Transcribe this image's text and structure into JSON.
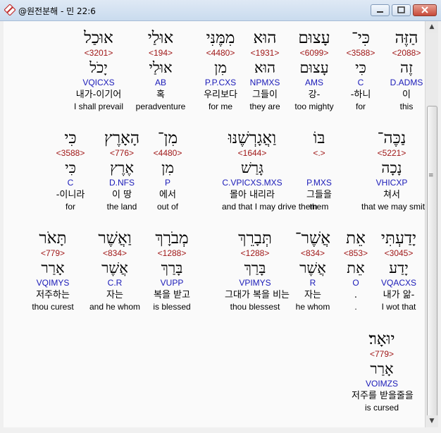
{
  "window": {
    "title": "@원전분해 - 민 22:6"
  },
  "rows": [
    [
      {
        "heb": "הַזֶּה",
        "num": "<2088>",
        "root": "זֶה",
        "parse": "D.ADMS",
        "kor": "이",
        "eng": "this"
      },
      {
        "heb": "כִּי־",
        "num": "<3588>",
        "root": "כִּי",
        "parse": "C",
        "kor": "-하니",
        "eng": "for"
      },
      {
        "heb": "עָצוּם",
        "num": "<6099>",
        "root": "עָצוּם",
        "parse": "AMS",
        "kor": "강-",
        "eng": "too mighty"
      },
      {
        "heb": "הוּא",
        "num": "<1931>",
        "root": "הוּא",
        "parse": "NPMXS",
        "kor": "그들이",
        "eng": "they are"
      },
      {
        "heb": "מִמֶּנִּי",
        "num": "<4480>",
        "root": "מִן",
        "parse": "P.P.CXS",
        "kor": "우리보다",
        "eng": "for me"
      },
      {
        "heb": "אוּלַי",
        "num": "<194>",
        "root": "אוּלַי",
        "parse": "AB",
        "kor": "혹",
        "eng": "peradventure"
      },
      {
        "heb": "אוּכַל",
        "num": "<3201>",
        "root": "יָכֹל",
        "parse": "VQICXS",
        "kor": "내가-이기어",
        "eng": "I shall prevail"
      }
    ],
    [
      {
        "heb": "נַכֶּה־",
        "num": "<5221>",
        "root": "נָכָה",
        "parse": "VHICXP",
        "kor": "쳐서",
        "eng": "that we may smite"
      },
      {
        "heb": "בּוֹ",
        "num": "<.>",
        "root": "",
        "parse": "P.MXS",
        "kor": "그들을",
        "eng": "them"
      },
      {
        "heb": "וַאֲגָרְשֶׁנּוּ",
        "num": "<1644>",
        "root": "גָּרַשׁ",
        "parse": "C.VPICXS.MXS",
        "kor": "몰아 내리라",
        "eng": "and that I may drive them"
      },
      {
        "heb": "מִן־",
        "num": "<4480>",
        "root": "מִן",
        "parse": "P",
        "kor": "에서",
        "eng": "out of"
      },
      {
        "heb": "הָאָרֶץ",
        "num": "<776>",
        "root": "אֶרֶץ",
        "parse": "D.NFS",
        "kor": "이 땅",
        "eng": "the land"
      },
      {
        "heb": "כִּי",
        "num": "<3588>",
        "root": "כִּי",
        "parse": "C",
        "kor": "-이니라",
        "eng": "for"
      }
    ],
    [
      {
        "heb": "יָדַעְתִּי",
        "num": "<3045>",
        "root": "יָדַע",
        "parse": "VQACXS",
        "kor": "내가 앎-",
        "eng": "I wot that"
      },
      {
        "heb": "אֵת",
        "num": "<853>",
        "root": "אֵת",
        "parse": "O",
        "kor": ".",
        "eng": "."
      },
      {
        "heb": "אֲשֶׁר־",
        "num": "<834>",
        "root": "אֲשֶׁר",
        "parse": "R",
        "kor": "자는",
        "eng": "he whom"
      },
      {
        "heb": "תְּבָרֵךְ",
        "num": "<1288>",
        "root": "בָּרַךְ",
        "parse": "VPIMYS",
        "kor": "그대가 복을 비는",
        "eng": "thou blessest"
      },
      {
        "heb": "מְבֹרָךְ",
        "num": "<1288>",
        "root": "בָּרַךְ",
        "parse": "VUPP",
        "kor": "복을 받고",
        "eng": "is blessed"
      },
      {
        "heb": "וַאֲשֶׁר",
        "num": "<834>",
        "root": "אֲשֶׁר",
        "parse": "C.R",
        "kor": "자는",
        "eng": "and he whom"
      },
      {
        "heb": "תָּאֹר",
        "num": "<779>",
        "root": "אָרַר",
        "parse": "VQIMYS",
        "kor": "저주하는",
        "eng": "thou curest"
      }
    ],
    [
      {
        "heb": "יוּאָר׃",
        "num": "<779>",
        "root": "אָרַר",
        "parse": "VOIMZS",
        "kor": "저주를 받을줄을",
        "eng": "is cursed"
      }
    ]
  ]
}
